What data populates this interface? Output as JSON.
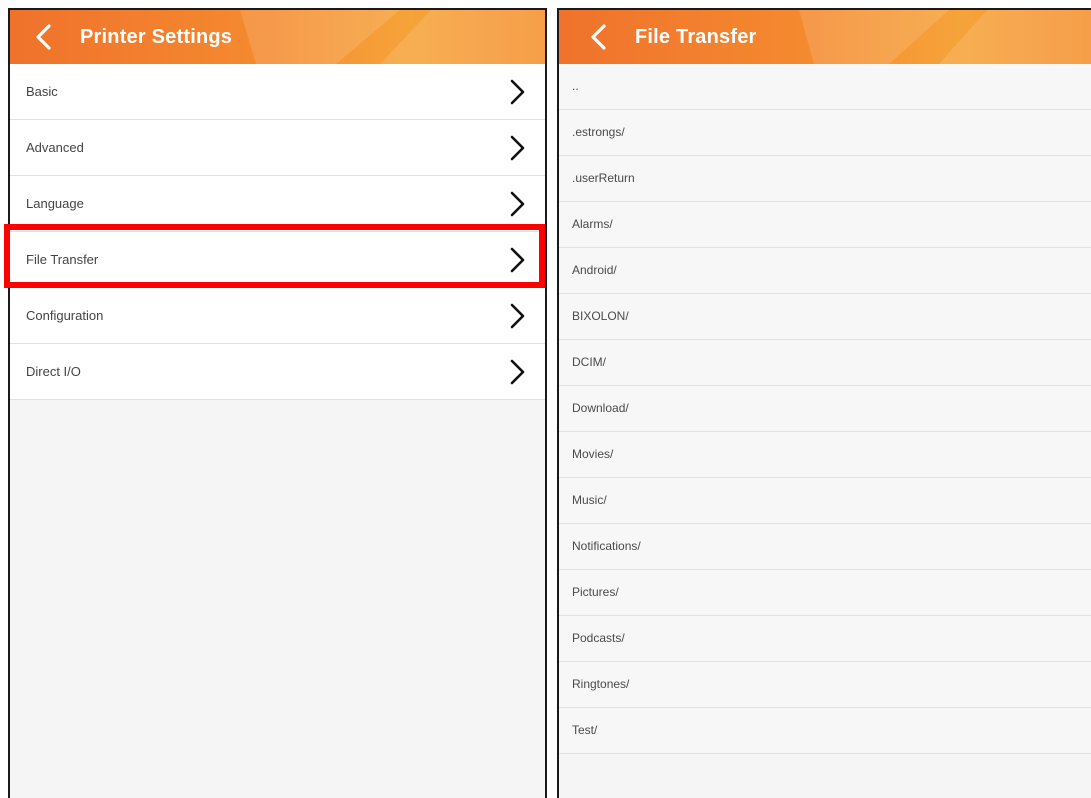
{
  "colors": {
    "appbar_start": "#f0722c",
    "appbar_end": "#f6a33a",
    "highlight": "#ff0000",
    "list_text": "#444444"
  },
  "left_screen": {
    "title": "Printer Settings",
    "back_icon": "chevron-left-icon",
    "items": [
      {
        "label": "Basic",
        "icon": "chevron-right-icon"
      },
      {
        "label": "Advanced",
        "icon": "chevron-right-icon"
      },
      {
        "label": "Language",
        "icon": "chevron-right-icon"
      },
      {
        "label": "File Transfer",
        "icon": "chevron-right-icon",
        "highlighted": true
      },
      {
        "label": "Configuration",
        "icon": "chevron-right-icon"
      },
      {
        "label": "Direct I/O",
        "icon": "chevron-right-icon"
      }
    ]
  },
  "right_screen": {
    "title": "File Transfer",
    "back_icon": "chevron-left-icon",
    "files": [
      "..",
      ".estrongs/",
      ".userReturn",
      "Alarms/",
      "Android/",
      "BIXOLON/",
      "DCIM/",
      "Download/",
      "Movies/",
      "Music/",
      "Notifications/",
      "Pictures/",
      "Podcasts/",
      "Ringtones/",
      "Test/"
    ]
  }
}
